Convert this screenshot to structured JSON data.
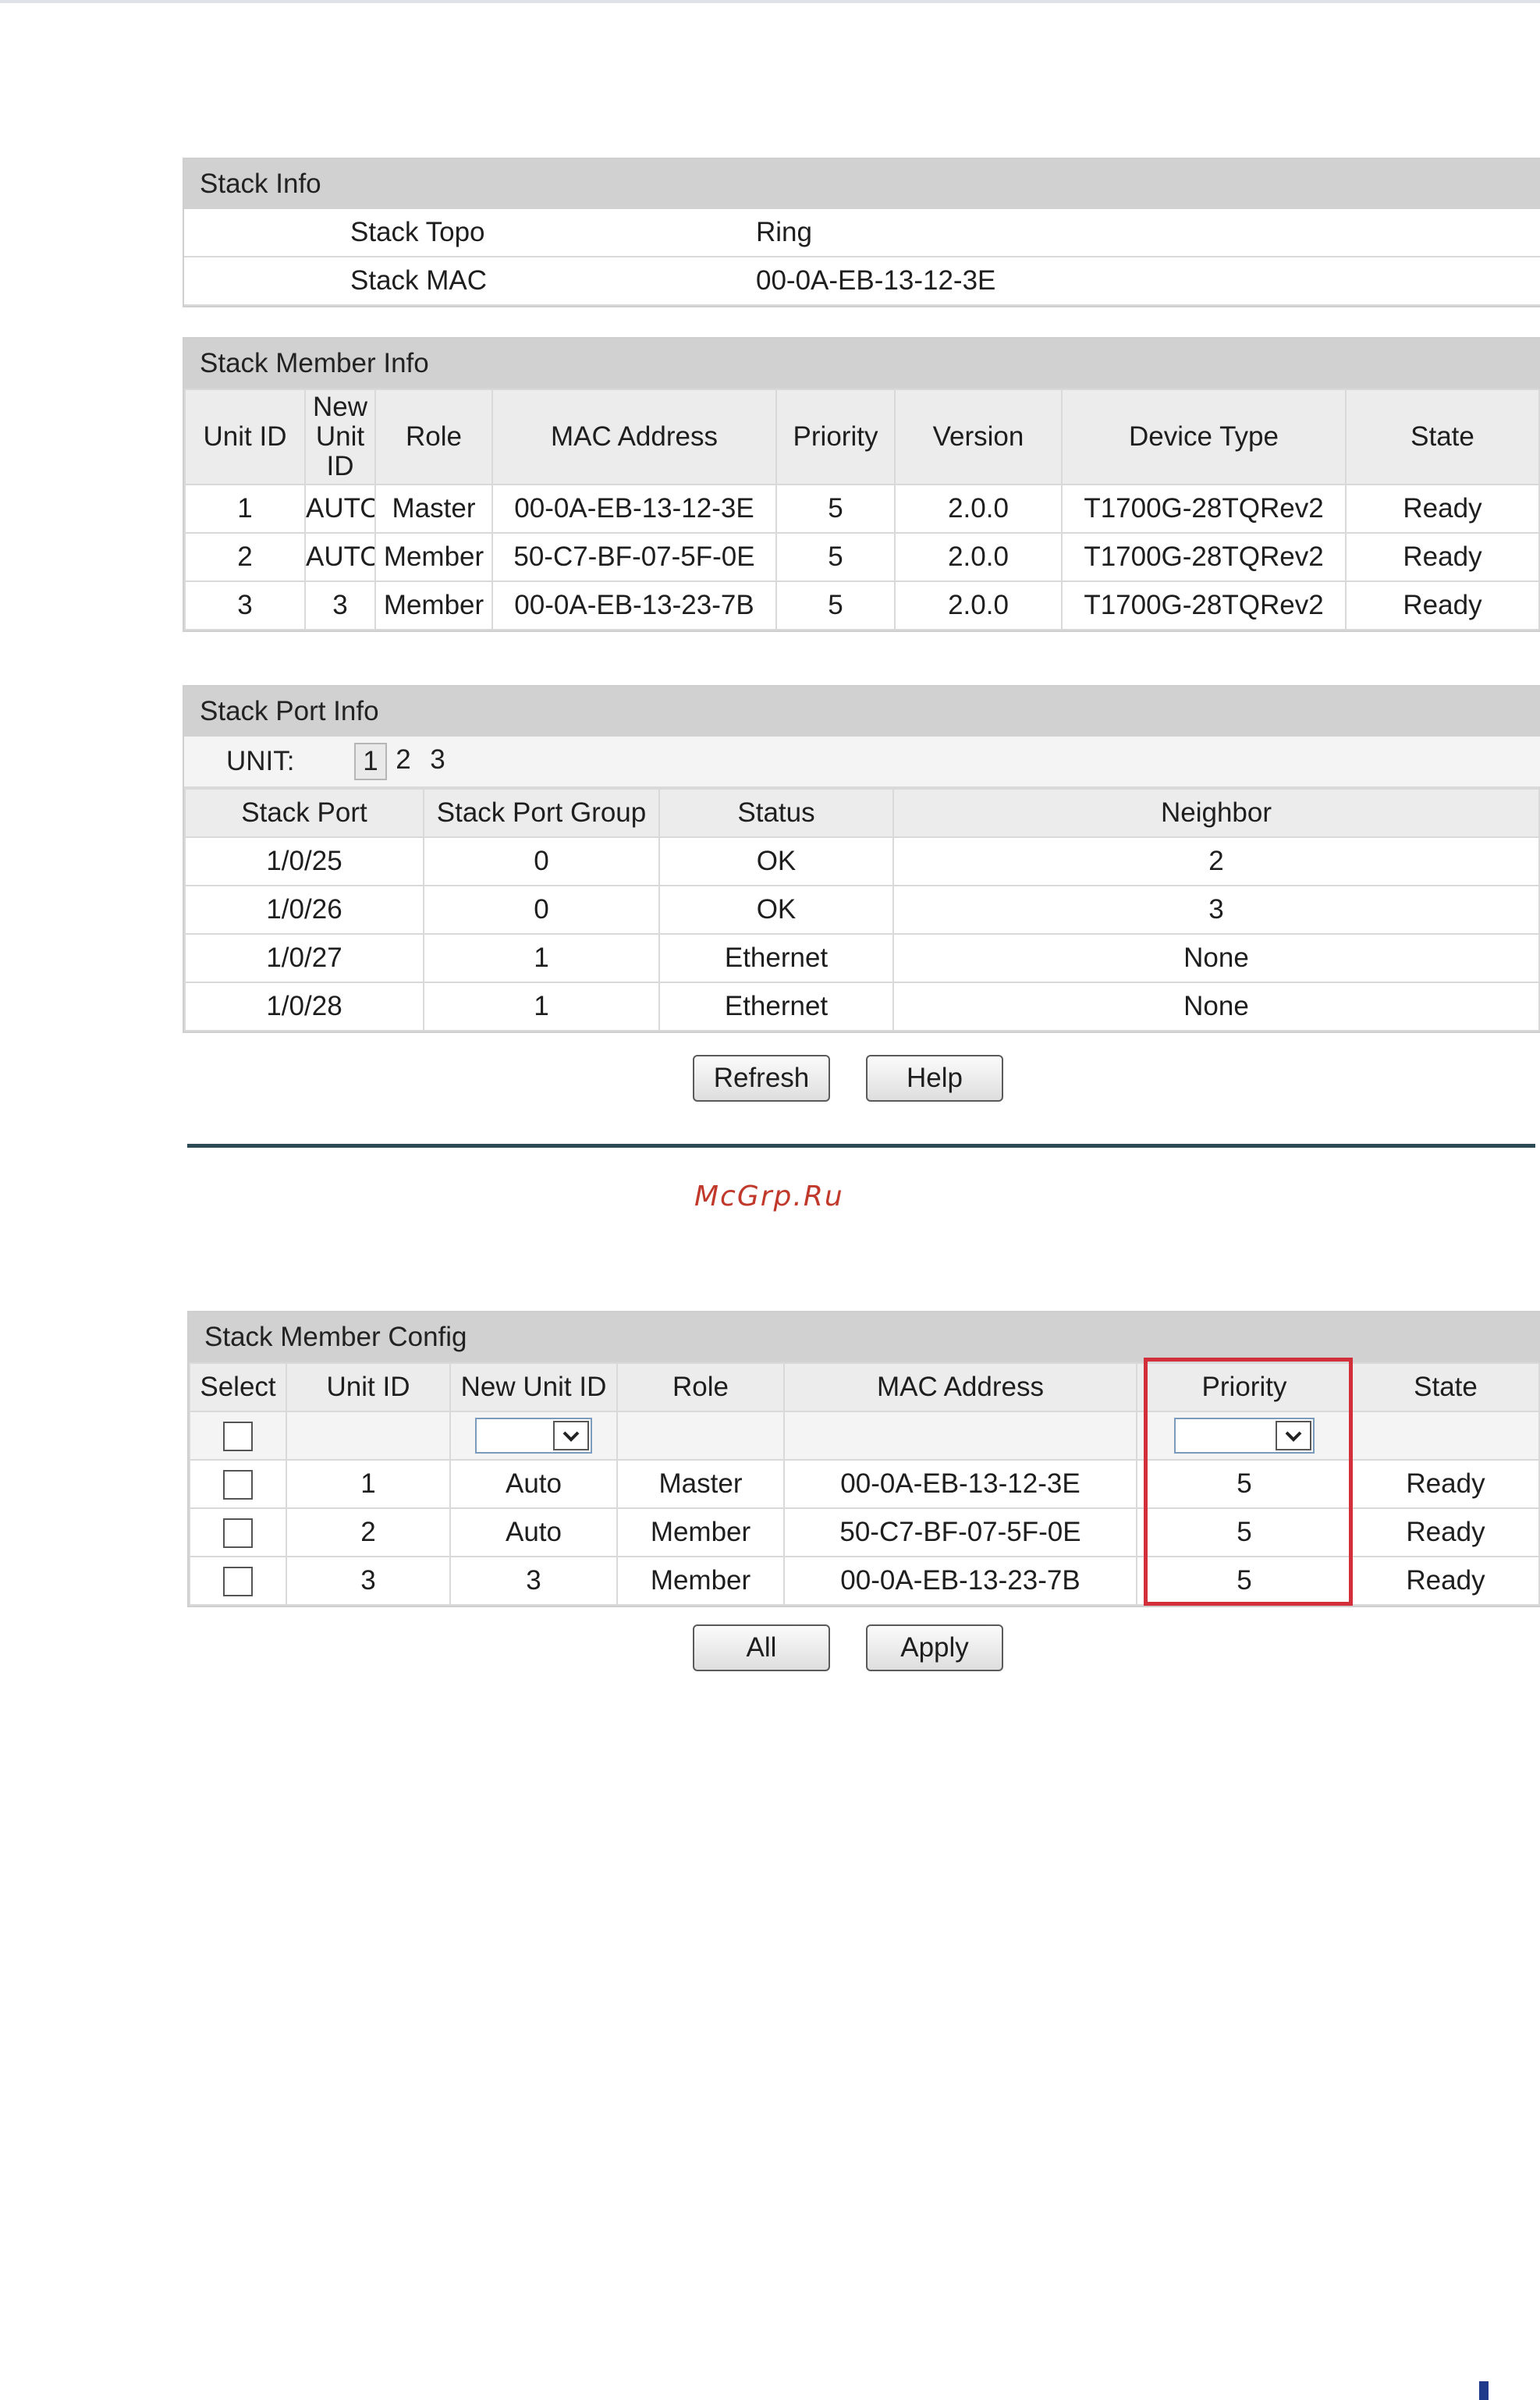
{
  "stack_info": {
    "title": "Stack Info",
    "rows": [
      {
        "label": "Stack Topo",
        "value": "Ring"
      },
      {
        "label": "Stack MAC",
        "value": "00-0A-EB-13-12-3E"
      }
    ]
  },
  "stack_member_info": {
    "title": "Stack Member Info",
    "headers": [
      "Unit ID",
      "New Unit ID",
      "Role",
      "MAC Address",
      "Priority",
      "Version",
      "Device Type",
      "State"
    ],
    "rows": [
      [
        "1",
        "AUTO",
        "Master",
        "00-0A-EB-13-12-3E",
        "5",
        "2.0.0",
        "T1700G-28TQRev2",
        "Ready"
      ],
      [
        "2",
        "AUTO",
        "Member",
        "50-C7-BF-07-5F-0E",
        "5",
        "2.0.0",
        "T1700G-28TQRev2",
        "Ready"
      ],
      [
        "3",
        "3",
        "Member",
        "00-0A-EB-13-23-7B",
        "5",
        "2.0.0",
        "T1700G-28TQRev2",
        "Ready"
      ]
    ]
  },
  "stack_port_info": {
    "title": "Stack Port Info",
    "unit_label": "UNIT:",
    "units": [
      "1",
      "2",
      "3"
    ],
    "selected_unit": "1",
    "headers": [
      "Stack Port",
      "Stack Port Group",
      "Status",
      "Neighbor"
    ],
    "rows": [
      [
        "1/0/25",
        "0",
        "OK",
        "2"
      ],
      [
        "1/0/26",
        "0",
        "OK",
        "3"
      ],
      [
        "1/0/27",
        "1",
        "Ethernet",
        "None"
      ],
      [
        "1/0/28",
        "1",
        "Ethernet",
        "None"
      ]
    ],
    "refresh_label": "Refresh",
    "help_label": "Help"
  },
  "watermark": "McGrp.Ru",
  "stack_member_config": {
    "title": "Stack Member Config",
    "headers": [
      "Select",
      "Unit ID",
      "New Unit ID",
      "Role",
      "MAC Address",
      "Priority",
      "State"
    ],
    "rows": [
      [
        "1",
        "Auto",
        "Master",
        "00-0A-EB-13-12-3E",
        "5",
        "Ready"
      ],
      [
        "2",
        "Auto",
        "Member",
        "50-C7-BF-07-5F-0E",
        "5",
        "Ready"
      ],
      [
        "3",
        "3",
        "Member",
        "00-0A-EB-13-23-7B",
        "5",
        "Ready"
      ]
    ],
    "all_label": "All",
    "apply_label": "Apply"
  },
  "colors": {
    "highlight": "#d32f3a",
    "header_bg": "#d1d1d1",
    "rule": "#2c4a56",
    "watermark": "#c0392b"
  }
}
